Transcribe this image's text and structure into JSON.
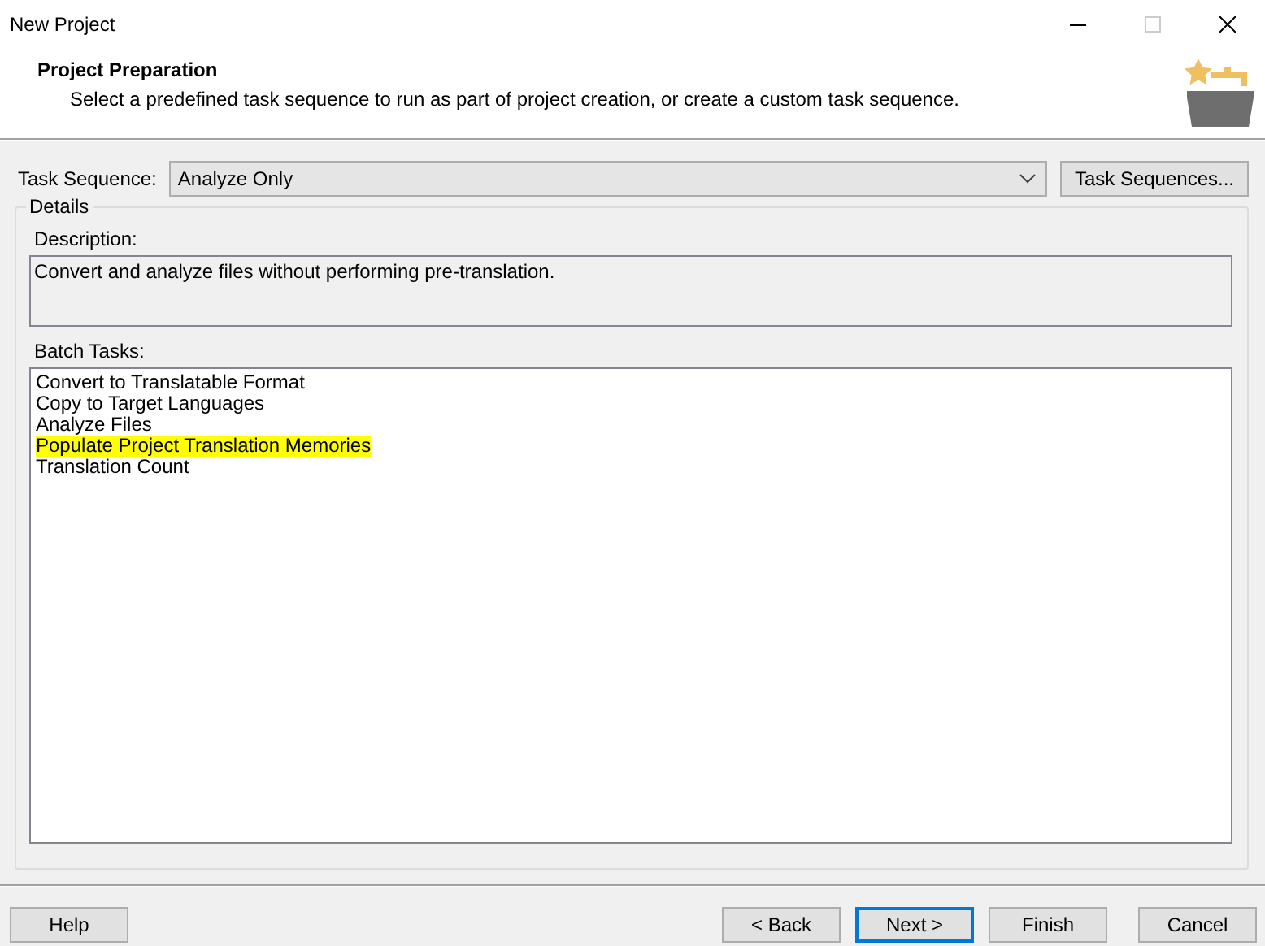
{
  "window": {
    "title": "New Project"
  },
  "header": {
    "title": "Project Preparation",
    "subtitle": "Select a predefined task sequence to run as part of project creation, or create a custom task sequence."
  },
  "task_sequence": {
    "label": "Task Sequence:",
    "value": "Analyze Only",
    "button": "Task Sequences..."
  },
  "details": {
    "legend": "Details",
    "description_label": "Description:",
    "description": "Convert and analyze files without performing pre-translation.",
    "batch_label": "Batch Tasks:",
    "batch_tasks": [
      {
        "label": "Convert to Translatable Format",
        "highlighted": false
      },
      {
        "label": "Copy to Target Languages",
        "highlighted": false
      },
      {
        "label": "Analyze Files",
        "highlighted": false
      },
      {
        "label": "Populate Project Translation Memories",
        "highlighted": true
      },
      {
        "label": "Translation Count",
        "highlighted": false
      }
    ]
  },
  "left_buttons": [
    {
      "label": "Help",
      "default": false
    }
  ],
  "right_buttons": [
    {
      "label": "< Back",
      "default": false
    },
    {
      "label": "Next >",
      "default": true
    },
    {
      "label": "Finish",
      "default": false
    },
    {
      "label": "Cancel",
      "default": false
    }
  ]
}
